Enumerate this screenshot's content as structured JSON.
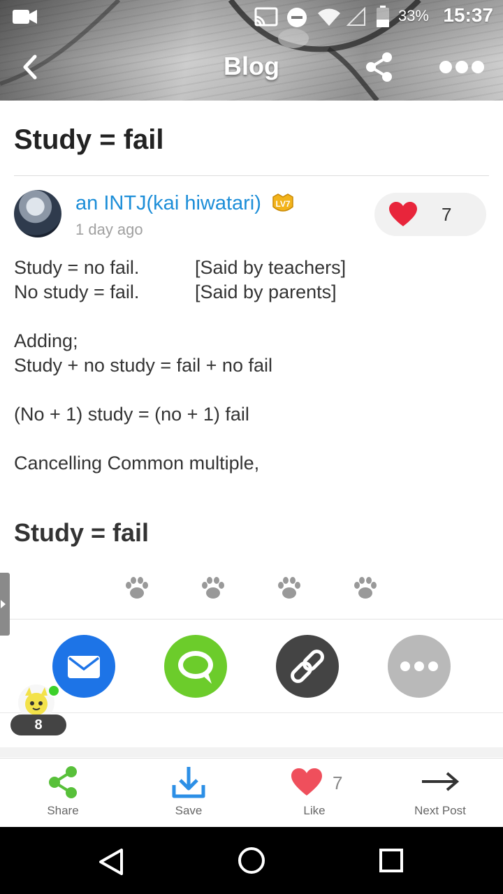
{
  "status_bar": {
    "battery_percent": "33%",
    "time": "15:37",
    "icons": [
      "video-camera-icon",
      "cast-icon",
      "do-not-disturb-icon",
      "wifi-icon",
      "signal-icon",
      "battery-icon"
    ]
  },
  "header": {
    "title": "Blog",
    "back_icon": "back-arrow-icon",
    "share_icon": "share-icon",
    "more_icon": "more-icon"
  },
  "post": {
    "title": "Study = fail",
    "author": "an INTJ(kai hiwatari)",
    "level_badge": "LV7",
    "time_ago": "1 day ago",
    "like_count": "7",
    "body": {
      "line1_left": "Study = no fail.",
      "line1_right": "[Said by teachers]",
      "line2_left": "No study = fail.",
      "line2_right": "[Said by parents]",
      "line3": "Adding;",
      "line4": "Study + no study = fail + no fail",
      "line5": "(No + 1) study = (no + 1) fail",
      "line6": "Cancelling Common multiple,"
    },
    "subheading": "Study = fail"
  },
  "share_row": {
    "items": [
      "mail-icon",
      "chat-icon",
      "link-icon",
      "more-icon"
    ],
    "colors": [
      "#1d74e7",
      "#6ccc2b",
      "#444444",
      "#b9b9b9"
    ]
  },
  "floating": {
    "count": "8"
  },
  "bottom_bar": {
    "share_label": "Share",
    "save_label": "Save",
    "like_label": "Like",
    "like_count": "7",
    "next_label": "Next Post"
  },
  "colors": {
    "link_blue": "#1d8ed8",
    "heart_red": "#e8253b",
    "share_green": "#58c03a",
    "save_blue": "#2c8fe6"
  }
}
